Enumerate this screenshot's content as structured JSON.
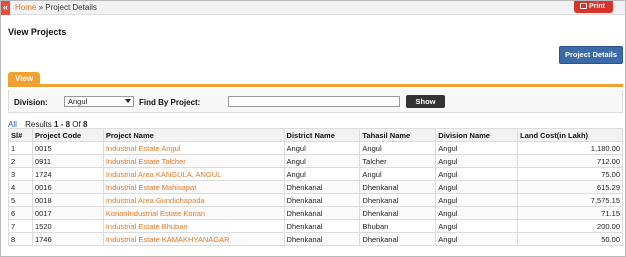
{
  "topbar": {
    "handle_glyph": "«",
    "home_link": "Home",
    "separator": "»",
    "current": "Project Details",
    "print_label": "Print"
  },
  "page": {
    "title": "View Projects",
    "project_details_button": "Project Details"
  },
  "tabs": [
    {
      "label": "View",
      "active": true
    }
  ],
  "filters": {
    "division_label": "Division:",
    "division_value": "Angul",
    "find_label": "Find By Project:",
    "find_value": "",
    "show_button": "Show"
  },
  "results": {
    "all_link": "All",
    "prefix": "Results",
    "range": "1 - 8",
    "of_word": "Of",
    "total": "8"
  },
  "table": {
    "headers": [
      "Sl#",
      "Project Code",
      "Project Name",
      "District Name",
      "Tahasil Name",
      "Division Name",
      "Land Cost(in Lakh)"
    ],
    "rows": [
      [
        "1",
        "0015",
        "Industrial Estate Angul",
        "Angul",
        "Angul",
        "Angul",
        "1,180.00"
      ],
      [
        "2",
        "0911",
        "Industrial Estate Talcher",
        "Angul",
        "Talcher",
        "Angul",
        "712.00"
      ],
      [
        "3",
        "1724",
        "Industrial Area KANGULA, ANGUL",
        "Angul",
        "Angul",
        "Angul",
        "75.00"
      ],
      [
        "4",
        "0016",
        "Industrial Estate Mahisapat",
        "Dhenkanal",
        "Dhenkanal",
        "Angul",
        "615.29"
      ],
      [
        "5",
        "0018",
        "Industrial Area Gundichapada",
        "Dhenkanal",
        "Dhenkanal",
        "Angul",
        "7,575.15"
      ],
      [
        "6",
        "0017",
        "KorianIndustrial Estate Korian",
        "Dhenkanal",
        "Dhenkanal",
        "Angul",
        "71.15"
      ],
      [
        "7",
        "1520",
        "Industrial Estate Bhuban",
        "Dhenkanal",
        "Bhuban",
        "Angul",
        "200.00"
      ],
      [
        "8",
        "1746",
        "Industrial Estate KAMAKHYANAGAR",
        "Dhenkanal",
        "Dhenkanal",
        "Angul",
        "50.00"
      ]
    ]
  },
  "colors": {
    "accent": "#f0a030",
    "link": "#e07b2a",
    "primary_button": "#3a6aa8",
    "print": "#d9342b"
  }
}
